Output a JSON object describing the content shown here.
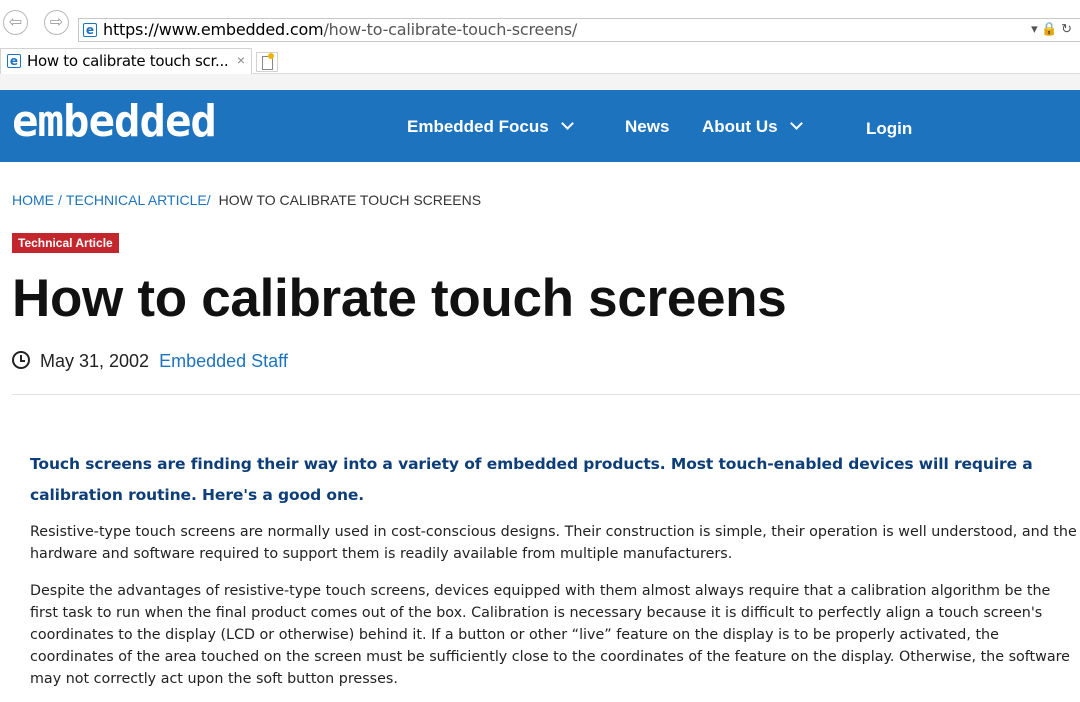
{
  "browser": {
    "url_domain": "https://www.embedded.com",
    "url_path": "/how-to-calibrate-touch-screens/",
    "favicon_letter": "e",
    "controls": "▾ 🔒 ↻",
    "tab_title": "How to calibrate touch scr...",
    "tab_close": "×"
  },
  "header": {
    "logo": "embedded",
    "nav": [
      {
        "label": "Embedded Focus",
        "dropdown": true
      },
      {
        "label": "News",
        "dropdown": false
      },
      {
        "label": "About Us",
        "dropdown": true
      },
      {
        "label": "Login",
        "dropdown": false
      }
    ],
    "color": "#1e73be"
  },
  "breadcrumb": {
    "home": "HOME",
    "sep1": "/",
    "section": "TECHNICAL ARTICLE",
    "sep2": "/",
    "current": "HOW TO CALIBRATE TOUCH SCREENS"
  },
  "article": {
    "category": "Technical Article",
    "title": "How to calibrate touch screens",
    "date": "May 31, 2002",
    "author": "Embedded Staff",
    "lead": "Touch screens are finding their way into a variety of embedded products. Most touch-enabled devices will require a calibration routine. Here's a good one.",
    "paragraphs": [
      "Resistive-type touch screens are normally used in cost-conscious designs. Their construction is simple, their operation is well understood, and the hardware and software required to support them is readily available from multiple manufacturers.",
      "Despite the advantages of resistive-type touch screens, devices equipped with them almost always require that a calibration algorithm be the first task to run when the final product comes out of the box. Calibration is necessary because it is difficult to perfectly align a touch screen's coordinates to the display (LCD or otherwise) behind it. If a button or other “live” feature on the display is to be properly activated, the coordinates of the area touched on the screen must be sufficiently close to the coordinates of the feature on the display. Otherwise, the software may not correctly act upon the soft button presses."
    ]
  }
}
